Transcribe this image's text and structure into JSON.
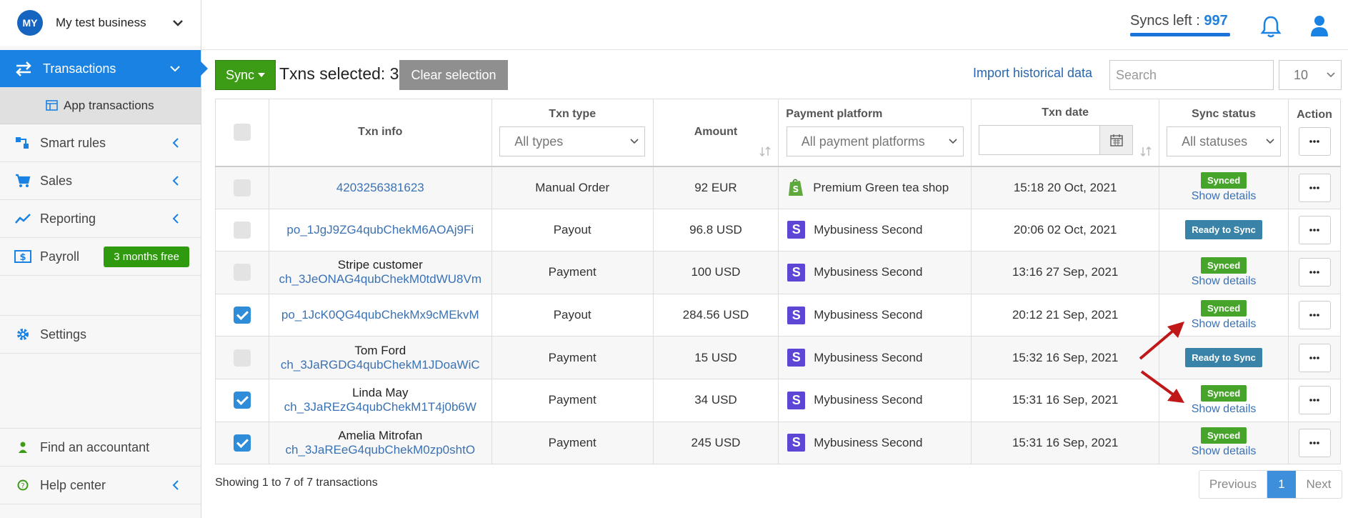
{
  "header": {
    "syncs_label": "Syncs left :",
    "syncs_value": "997"
  },
  "sidebar": {
    "avatar": "MY",
    "business_name": "My test business",
    "active_item": "Transactions",
    "sub_item": "App transactions",
    "items": [
      {
        "label": "Smart rules",
        "icon": "rules-icon"
      },
      {
        "label": "Sales",
        "icon": "cart-icon"
      },
      {
        "label": "Reporting",
        "icon": "chart-line-icon"
      },
      {
        "label": "Payroll",
        "icon": "dollar-icon",
        "badge": "3 months free"
      },
      {
        "label": "Settings",
        "icon": "gear-icon"
      },
      {
        "label": "Find an accountant",
        "icon": "person-icon"
      },
      {
        "label": "Help center",
        "icon": "help-icon"
      }
    ]
  },
  "toolbar": {
    "sync_label": "Sync",
    "txns_selected": "Txns selected: 3",
    "clear_label": "Clear selection",
    "import_label": "Import historical data",
    "search_placeholder": "Search",
    "per_page": "10"
  },
  "table": {
    "headers": {
      "txn_info": "Txn info",
      "txn_type": "Txn type",
      "amount": "Amount",
      "platform": "Payment platform",
      "date": "Txn date",
      "status": "Sync status",
      "action": "Action"
    },
    "filters": {
      "type": "All types",
      "platform": "All payment platforms",
      "status": "All statuses"
    },
    "rows": [
      {
        "checked": false,
        "name": "",
        "id": "4203256381623",
        "type": "Manual Order",
        "amount": "92 EUR",
        "platform": "Premium Green tea shop",
        "platform_icon": "shopify-icon",
        "date": "15:18 20 Oct, 2021",
        "status": "Synced",
        "details": "Show details"
      },
      {
        "checked": false,
        "name": "",
        "id": "po_1JgJ9ZG4qubChekM6AOAj9Fi",
        "type": "Payout",
        "amount": "96.8 USD",
        "platform": "Mybusiness Second",
        "platform_icon": "stripe-icon",
        "date": "20:06 02 Oct, 2021",
        "status": "Ready to Sync",
        "details": ""
      },
      {
        "checked": false,
        "name": "Stripe customer",
        "id": "ch_3JeONAG4qubChekM0tdWU8Vm",
        "type": "Payment",
        "amount": "100 USD",
        "platform": "Mybusiness Second",
        "platform_icon": "stripe-icon",
        "date": "13:16 27 Sep, 2021",
        "status": "Synced",
        "details": "Show details"
      },
      {
        "checked": true,
        "name": "",
        "id": "po_1JcK0QG4qubChekMx9cMEkvM",
        "type": "Payout",
        "amount": "284.56 USD",
        "platform": "Mybusiness Second",
        "platform_icon": "stripe-icon",
        "date": "20:12 21 Sep, 2021",
        "status": "Synced",
        "details": "Show details"
      },
      {
        "checked": false,
        "name": "Tom Ford",
        "id": "ch_3JaRGDG4qubChekM1JDoaWiC",
        "type": "Payment",
        "amount": "15 USD",
        "platform": "Mybusiness Second",
        "platform_icon": "stripe-icon",
        "date": "15:32 16 Sep, 2021",
        "status": "Ready to Sync",
        "details": ""
      },
      {
        "checked": true,
        "name": "Linda May",
        "id": "ch_3JaREzG4qubChekM1T4j0b6W",
        "type": "Payment",
        "amount": "34 USD",
        "platform": "Mybusiness Second",
        "platform_icon": "stripe-icon",
        "date": "15:31 16 Sep, 2021",
        "status": "Synced",
        "details": "Show details"
      },
      {
        "checked": true,
        "name": "Amelia Mitrofan",
        "id": "ch_3JaREeG4qubChekM0zp0shtO",
        "type": "Payment",
        "amount": "245 USD",
        "platform": "Mybusiness Second",
        "platform_icon": "stripe-icon",
        "date": "15:31 16 Sep, 2021",
        "status": "Synced",
        "details": "Show details"
      }
    ]
  },
  "footer": {
    "showing": "Showing 1 to 7 of 7 transactions",
    "prev": "Previous",
    "page": "1",
    "next": "Next"
  },
  "colors": {
    "accent": "#1a82e2",
    "sync_green": "#3d9c16",
    "synced_label": "#46a42a",
    "ready_label": "#3a83a8",
    "arrow": "#c01818"
  }
}
